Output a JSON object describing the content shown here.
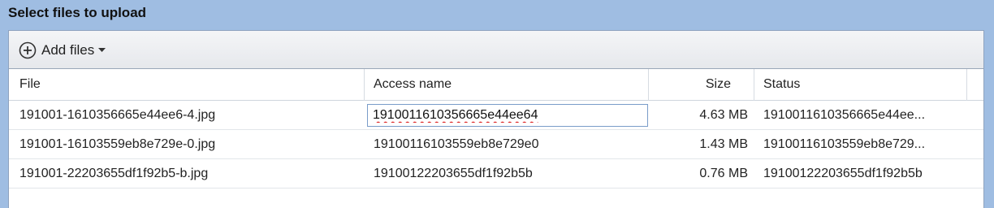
{
  "dialog": {
    "title": "Select files to upload"
  },
  "toolbar": {
    "add_files_label": "Add files",
    "add_icon": "plus-circle-icon",
    "caret_icon": "caret-down-icon"
  },
  "table": {
    "columns": [
      "File",
      "Access name",
      "Size",
      "Status"
    ],
    "rows": [
      {
        "file": "191001-1610356665e44ee6-4.jpg",
        "access_name": "1910011610356665e44ee64",
        "size": "4.63 MB",
        "status": "1910011610356665e44ee..."
      },
      {
        "file": "191001-16103559eb8e729e-0.jpg",
        "access_name": "19100116103559eb8e729e0",
        "size": "1.43 MB",
        "status": "19100116103559eb8e729..."
      },
      {
        "file": "191001-22203655df1f92b5-b.jpg",
        "access_name": "19100122203655df1f92b5b",
        "size": "0.76 MB",
        "status": "19100122203655df1f92b5b"
      }
    ]
  }
}
